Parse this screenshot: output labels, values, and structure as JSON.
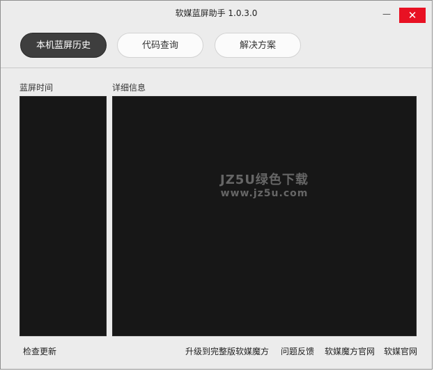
{
  "window": {
    "title": "软媒蓝屏助手 1.0.3.0",
    "minimize_glyph": "—",
    "close_glyph": "✕"
  },
  "tabs": [
    {
      "label": "本机蓝屏历史",
      "active": true
    },
    {
      "label": "代码查询",
      "active": false
    },
    {
      "label": "解决方案",
      "active": false
    }
  ],
  "labels": {
    "time": "蓝屏时间",
    "detail": "详细信息"
  },
  "watermark": {
    "line1": "JZ5U绿色下载",
    "line2": "www.jz5u.com"
  },
  "footer": {
    "check_update": "检查更新",
    "upgrade": "升级到完整版软媒魔方",
    "feedback": "问题反馈",
    "magic_site": "软媒魔方官网",
    "ruanmei_site": "软媒官网"
  },
  "colors": {
    "accent_close": "#e81123",
    "tab_active": "#3e3e3e",
    "panel_bg": "#171717"
  }
}
